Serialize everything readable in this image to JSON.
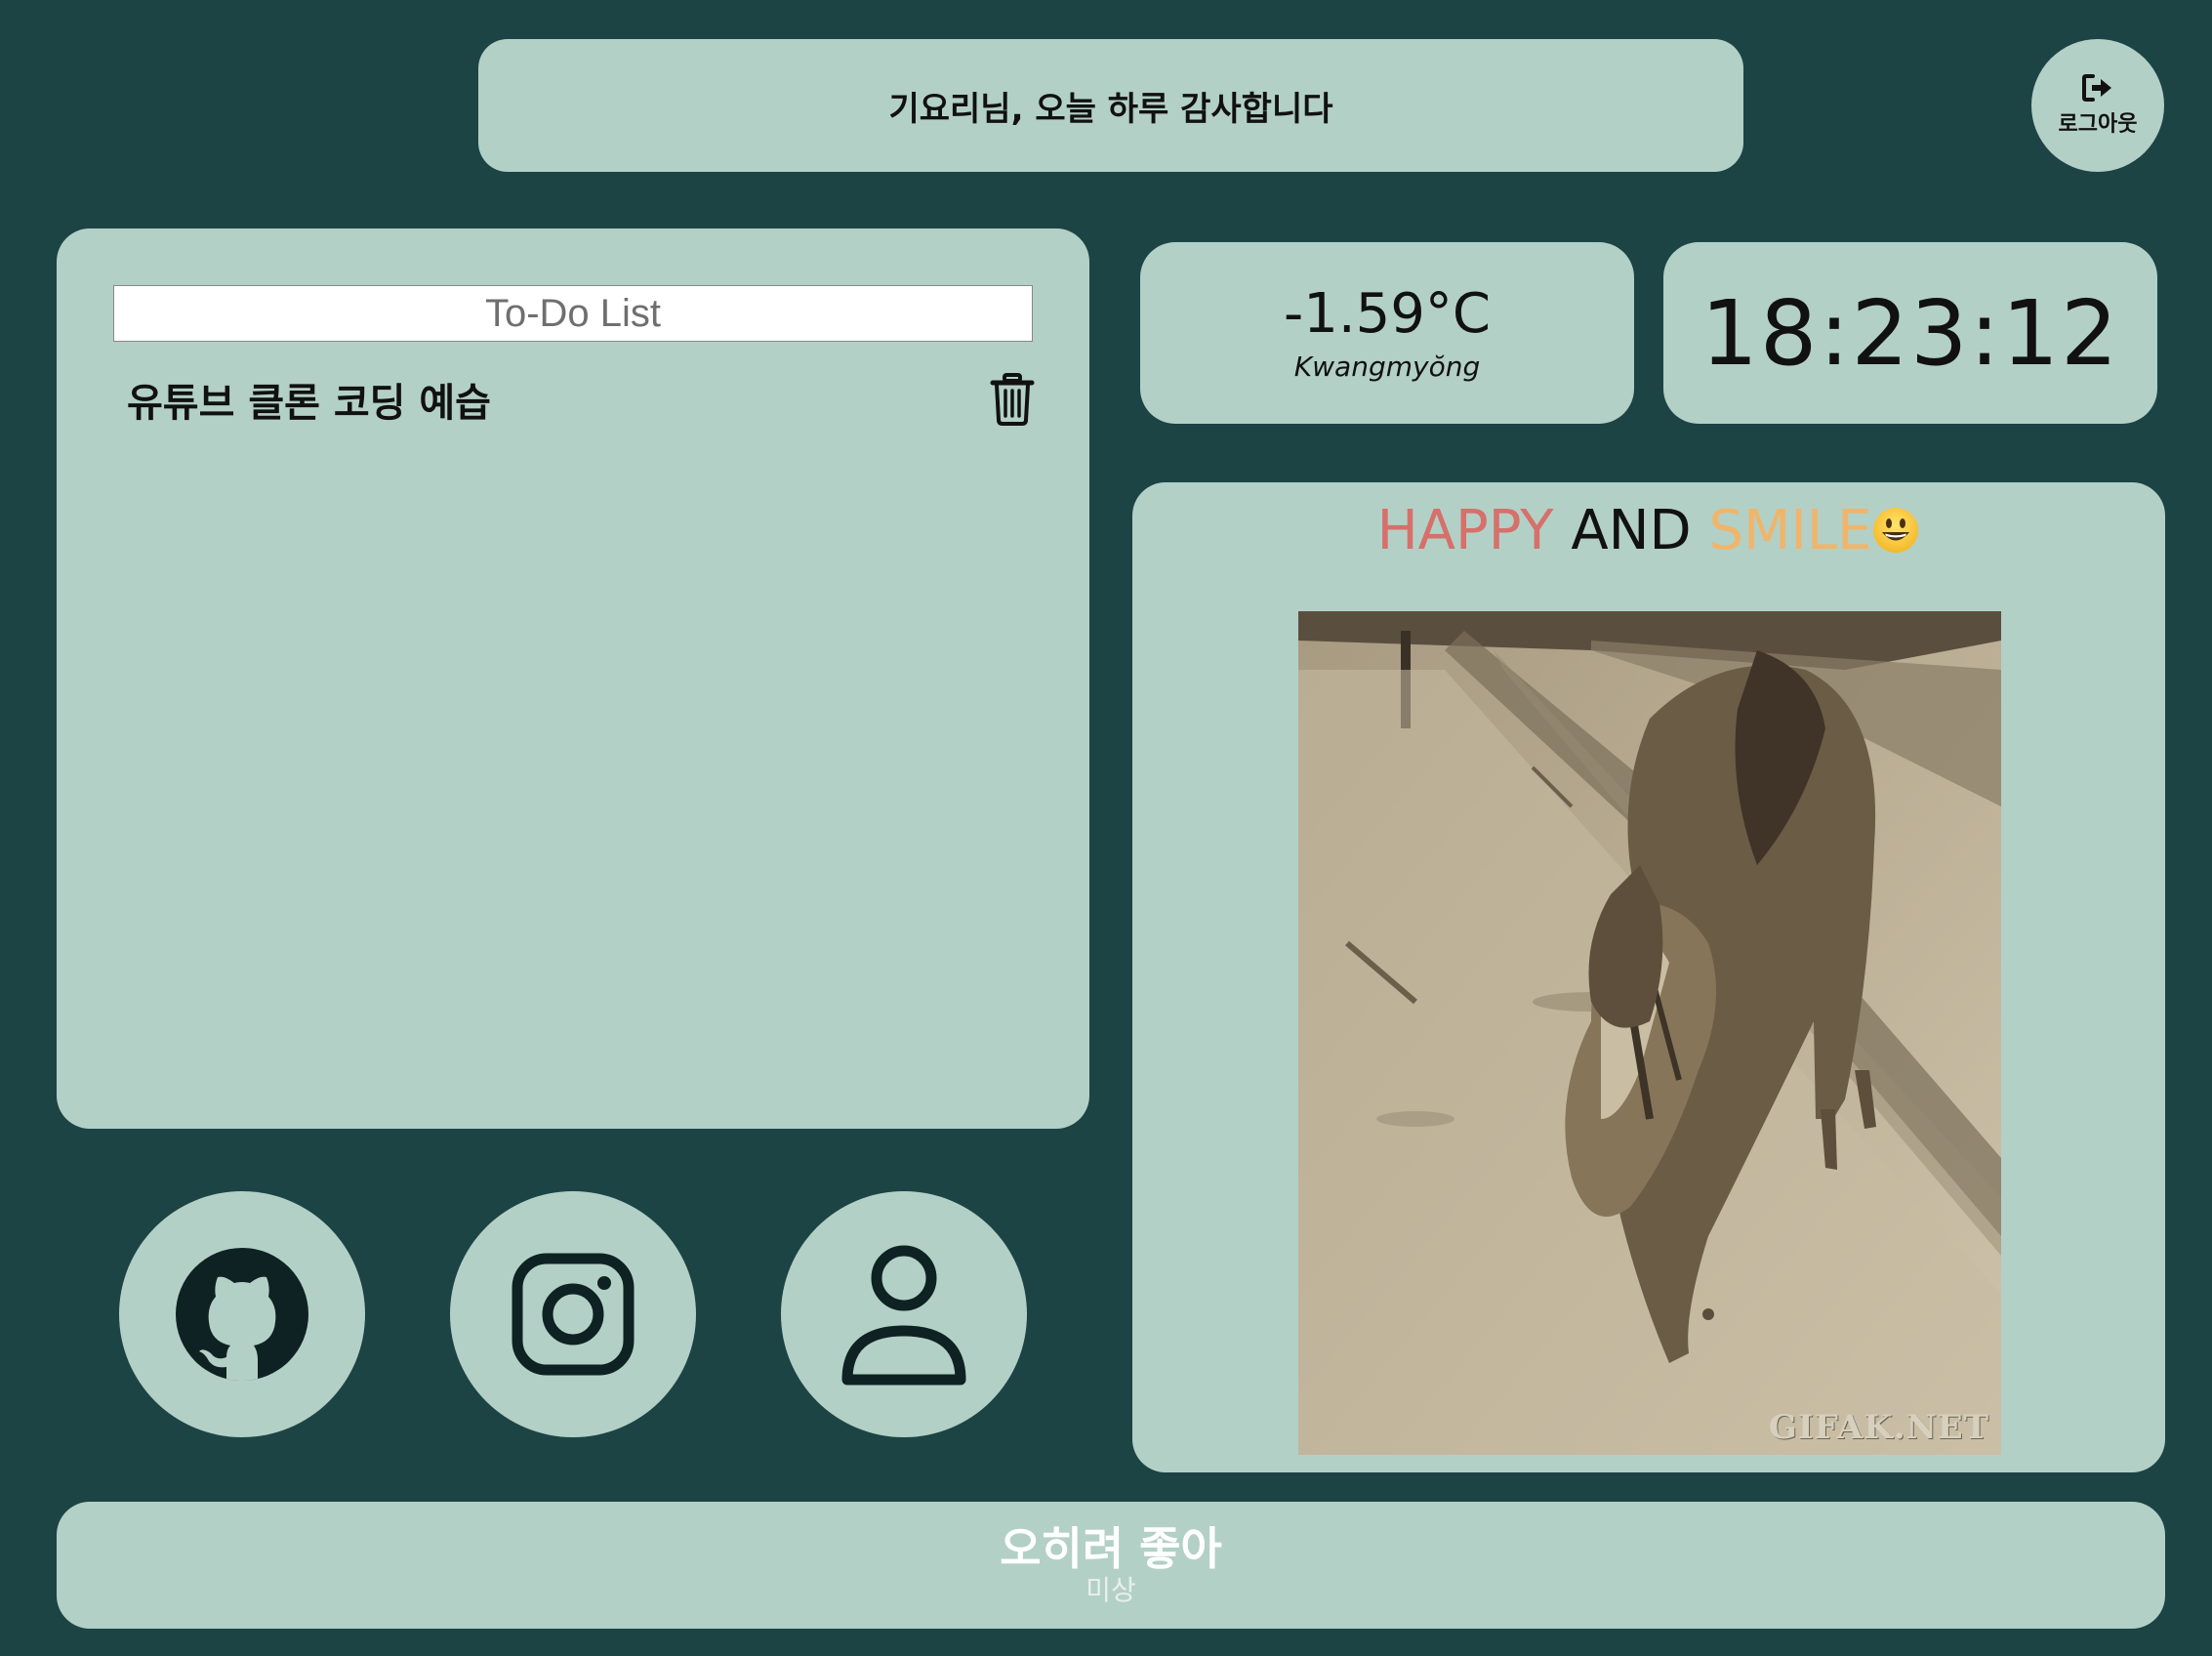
{
  "header": {
    "greeting": "기요리님, 오늘 하루 감사합니다",
    "logout_label": "로그아웃",
    "logout_icon": "sign-out-icon"
  },
  "todo": {
    "placeholder": "To-Do List",
    "items": [
      {
        "text": "유튜브 클론 코딩 예습",
        "delete_icon": "trash-icon"
      }
    ]
  },
  "weather": {
    "temperature": "-1.59°C",
    "location": "Kwangmyŏng"
  },
  "clock": {
    "time": "18:23:12"
  },
  "happy": {
    "word1": "HAPPY",
    "word2": "AND",
    "word3": "SMILE",
    "emoji": "grinning-face-emoji",
    "gif_watermark": "GIFAK.NET",
    "colors": {
      "happy": "#d6706b",
      "and": "#111111",
      "smile": "#f0b56a"
    }
  },
  "social": [
    {
      "icon": "github-icon"
    },
    {
      "icon": "instagram-icon"
    },
    {
      "icon": "user-icon"
    }
  ],
  "song": {
    "title": "오히려 좋아",
    "artist": "미상"
  },
  "colors": {
    "background": "#1c4445",
    "panel": "#b3d0c6"
  }
}
